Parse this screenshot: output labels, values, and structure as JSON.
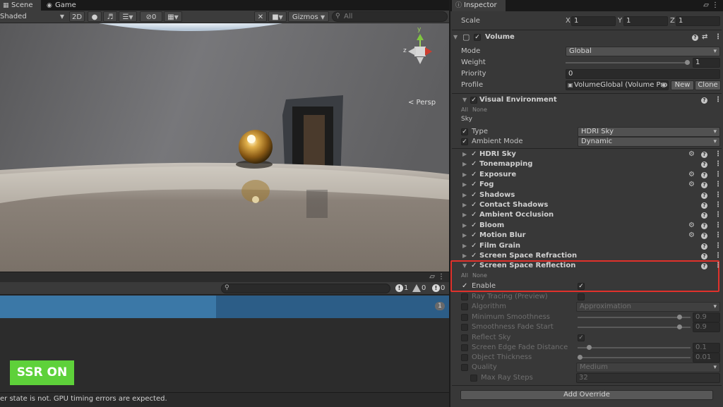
{
  "scene_tabs": [
    {
      "label": "Scene",
      "icon": "grid-icon"
    },
    {
      "label": "Game",
      "icon": "gamepad-icon"
    }
  ],
  "scene_toolbar": {
    "shading_mode": "Shaded",
    "mode_2d": "2D",
    "hidden_count": "0",
    "gizmos": "Gizmos",
    "search_placeholder": "All"
  },
  "viewport": {
    "projection": "< Persp",
    "axis_y": "y",
    "axis_z": "z"
  },
  "console": {
    "error_count": "1",
    "warning_count": "0",
    "info_count": "0",
    "collapsed_count": "1"
  },
  "overlay": {
    "ssr_label": "SSR ON",
    "color": "#5ed13a"
  },
  "status_bar": "er state is not. GPU timing errors are expected.",
  "inspector": {
    "tab": "Inspector",
    "transform_scale": {
      "label": "Scale",
      "x": "1",
      "y": "1",
      "z": "1",
      "x_label": "X",
      "y_label": "Y",
      "z_label": "Z"
    },
    "volume": {
      "title": "Volume",
      "mode_label": "Mode",
      "mode_value": "Global",
      "weight_label": "Weight",
      "weight_value": "1",
      "weight_fraction": 1.0,
      "priority_label": "Priority",
      "priority_value": "0",
      "profile_label": "Profile",
      "profile_value": "VolumeGlobal (Volume Pro",
      "new_button": "New",
      "clone_button": "Clone"
    },
    "visual_environment": {
      "title": "Visual Environment",
      "all": "All",
      "none": "None",
      "sky_header": "Sky",
      "type_label": "Type",
      "type_value": "HDRI Sky",
      "ambient_label": "Ambient Mode",
      "ambient_value": "Dynamic"
    },
    "components": [
      {
        "name": "HDRI Sky",
        "gear": true
      },
      {
        "name": "Tonemapping",
        "gear": false
      },
      {
        "name": "Exposure",
        "gear": true
      },
      {
        "name": "Fog",
        "gear": true
      },
      {
        "name": "Shadows",
        "gear": false
      },
      {
        "name": "Contact Shadows",
        "gear": false
      },
      {
        "name": "Ambient Occlusion",
        "gear": false
      },
      {
        "name": "Bloom",
        "gear": true
      },
      {
        "name": "Motion Blur",
        "gear": true
      },
      {
        "name": "Film Grain",
        "gear": false
      },
      {
        "name": "Screen Space Refraction",
        "gear": false
      }
    ],
    "ssr": {
      "title": "Screen Space Reflection",
      "all": "All",
      "none": "None",
      "enable_label": "Enable",
      "ray_tracing_label": "Ray Tracing (Preview)",
      "algorithm_label": "Algorithm",
      "algorithm_value": "Approximation",
      "min_smooth_label": "Minimum Smoothness",
      "min_smooth_value": "0.9",
      "min_smooth_fraction": 0.9,
      "smooth_fade_label": "Smoothness Fade Start",
      "smooth_fade_value": "0.9",
      "smooth_fade_fraction": 0.9,
      "reflect_sky_label": "Reflect Sky",
      "edge_fade_label": "Screen Edge Fade Distance",
      "edge_fade_value": "0.1",
      "edge_fade_fraction": 0.1,
      "thickness_label": "Object Thickness",
      "thickness_value": "0.01",
      "thickness_fraction": 0.01,
      "quality_label": "Quality",
      "quality_value": "Medium",
      "max_ray_label": "Max Ray Steps",
      "max_ray_value": "32"
    },
    "add_override": "Add Override"
  }
}
